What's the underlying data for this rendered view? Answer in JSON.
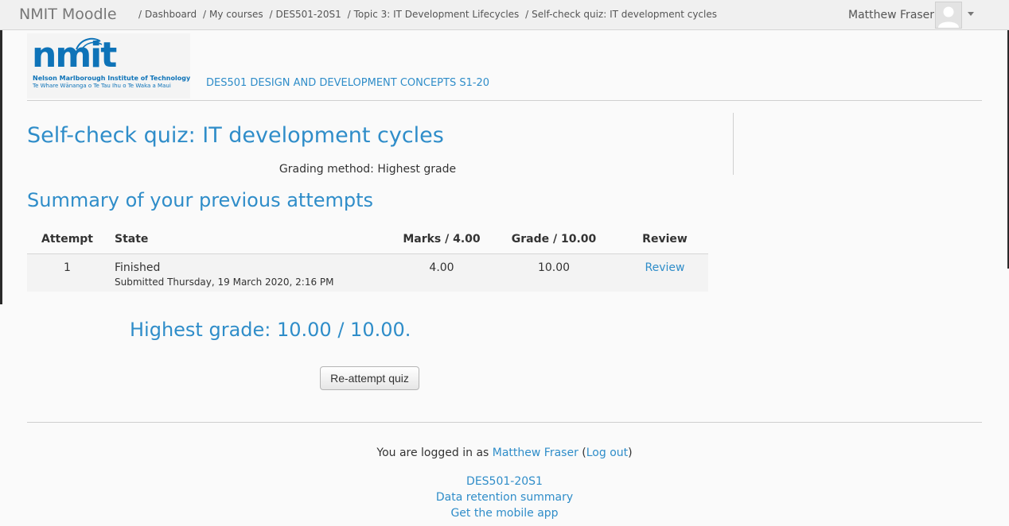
{
  "navbar": {
    "brand": "NMIT Moodle",
    "breadcrumbs": [
      "Dashboard",
      "My courses",
      "DES501-20S1",
      "Topic 3: IT Development Lifecycles",
      "Self-check quiz: IT development cycles"
    ],
    "user_name": "Matthew Fraser"
  },
  "header": {
    "logo_word": "nmit",
    "logo_line1": "Nelson Marlborough Institute of Technology",
    "logo_line2": "Te Whare Wānanga o Te Tau Ihu o Te Waka a Maui",
    "course_name": "DES501 DESIGN AND DEVELOPMENT CONCEPTS S1-20"
  },
  "main": {
    "title": "Self-check quiz: IT development cycles",
    "grading_method": "Grading method: Highest grade",
    "summary_title": "Summary of your previous attempts",
    "table": {
      "headers": [
        "Attempt",
        "State",
        "Marks / 4.00",
        "Grade / 10.00",
        "Review"
      ],
      "rows": [
        {
          "attempt": "1",
          "state": "Finished",
          "submitted": "Submitted Thursday, 19 March 2020, 2:16 PM",
          "marks": "4.00",
          "grade": "10.00",
          "review": "Review"
        }
      ]
    },
    "highest_grade": "Highest grade: 10.00 / 10.00.",
    "reattempt_label": "Re-attempt quiz"
  },
  "footer": {
    "logged_in_prefix": "You are logged in as",
    "user_name": "Matthew Fraser",
    "logout_label": "Log out",
    "links": [
      "DES501-20S1",
      "Data retention summary",
      "Get the mobile app"
    ]
  },
  "colors": {
    "accent": "#2f8dc9",
    "logo": "#0e73b8",
    "navbar_bg": "#f0f0f0"
  }
}
